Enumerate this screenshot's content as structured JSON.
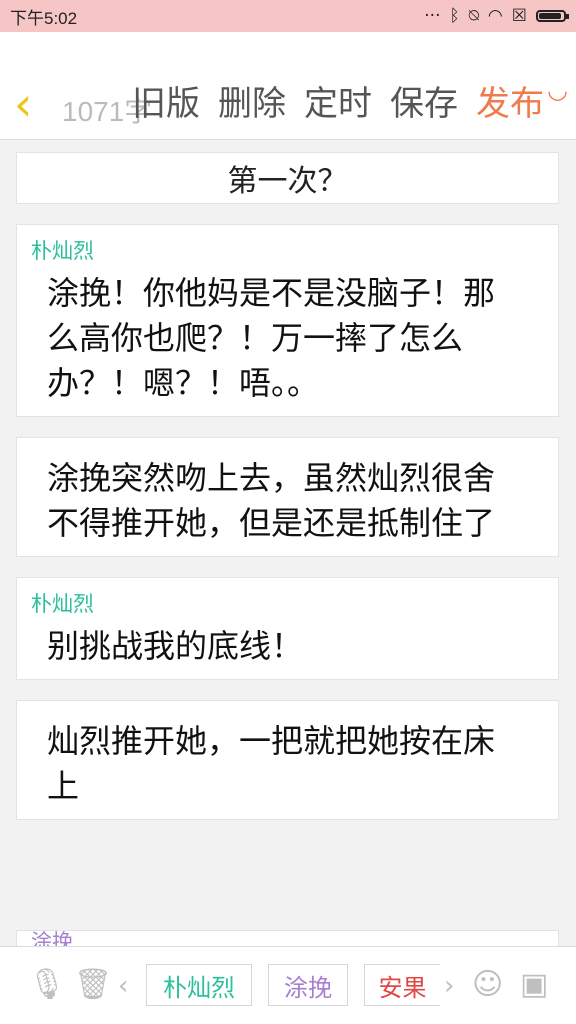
{
  "status_bar": {
    "time": "下午5:02",
    "icons": [
      "dots-icon",
      "bluetooth-icon",
      "mute-icon",
      "wifi-icon",
      "sim-off-icon",
      "battery-icon"
    ],
    "battery_level": 0.9
  },
  "header": {
    "back_icon": "chevron-left-icon",
    "counter": "1071字",
    "actions": {
      "old_version": "旧版",
      "delete": "删除",
      "schedule": "定时",
      "save": "保存",
      "publish": "发布"
    },
    "smile_icon": "smile-icon",
    "colors": {
      "accent": "#f07a4a",
      "back": "#f0c419"
    }
  },
  "story": {
    "title": "第一次？",
    "blocks": [
      {
        "speaker": "朴灿烈",
        "text": "涂挽！你他妈是不是没脑子！那么高你也爬？！万一摔了怎么办？！嗯？！唔。。"
      },
      {
        "speaker": "",
        "text": "涂挽突然吻上去，虽然灿烈很舍不得推开她，但是还是抵制住了"
      },
      {
        "speaker": "朴灿烈",
        "text": "别挑战我的底线！"
      },
      {
        "speaker": "",
        "text": "灿烈推开她，一把就把她按在床上"
      },
      {
        "speaker": "涂挽",
        "text": ""
      }
    ],
    "speaker_color": "#2bbf9c"
  },
  "toolbar": {
    "mic_icon": "microphone-icon",
    "trash_icon": "trash-icon",
    "prev_icon": "chevron-left-icon",
    "next_icon": "chevron-right-icon",
    "emoji_icon": "emoji-icon",
    "image_icon": "image-icon",
    "characters": [
      {
        "name": "朴灿烈",
        "color": "#2bbf9c"
      },
      {
        "name": "涂挽",
        "color": "#a67fd0"
      },
      {
        "name": "安果",
        "color": "#e04848"
      }
    ]
  }
}
